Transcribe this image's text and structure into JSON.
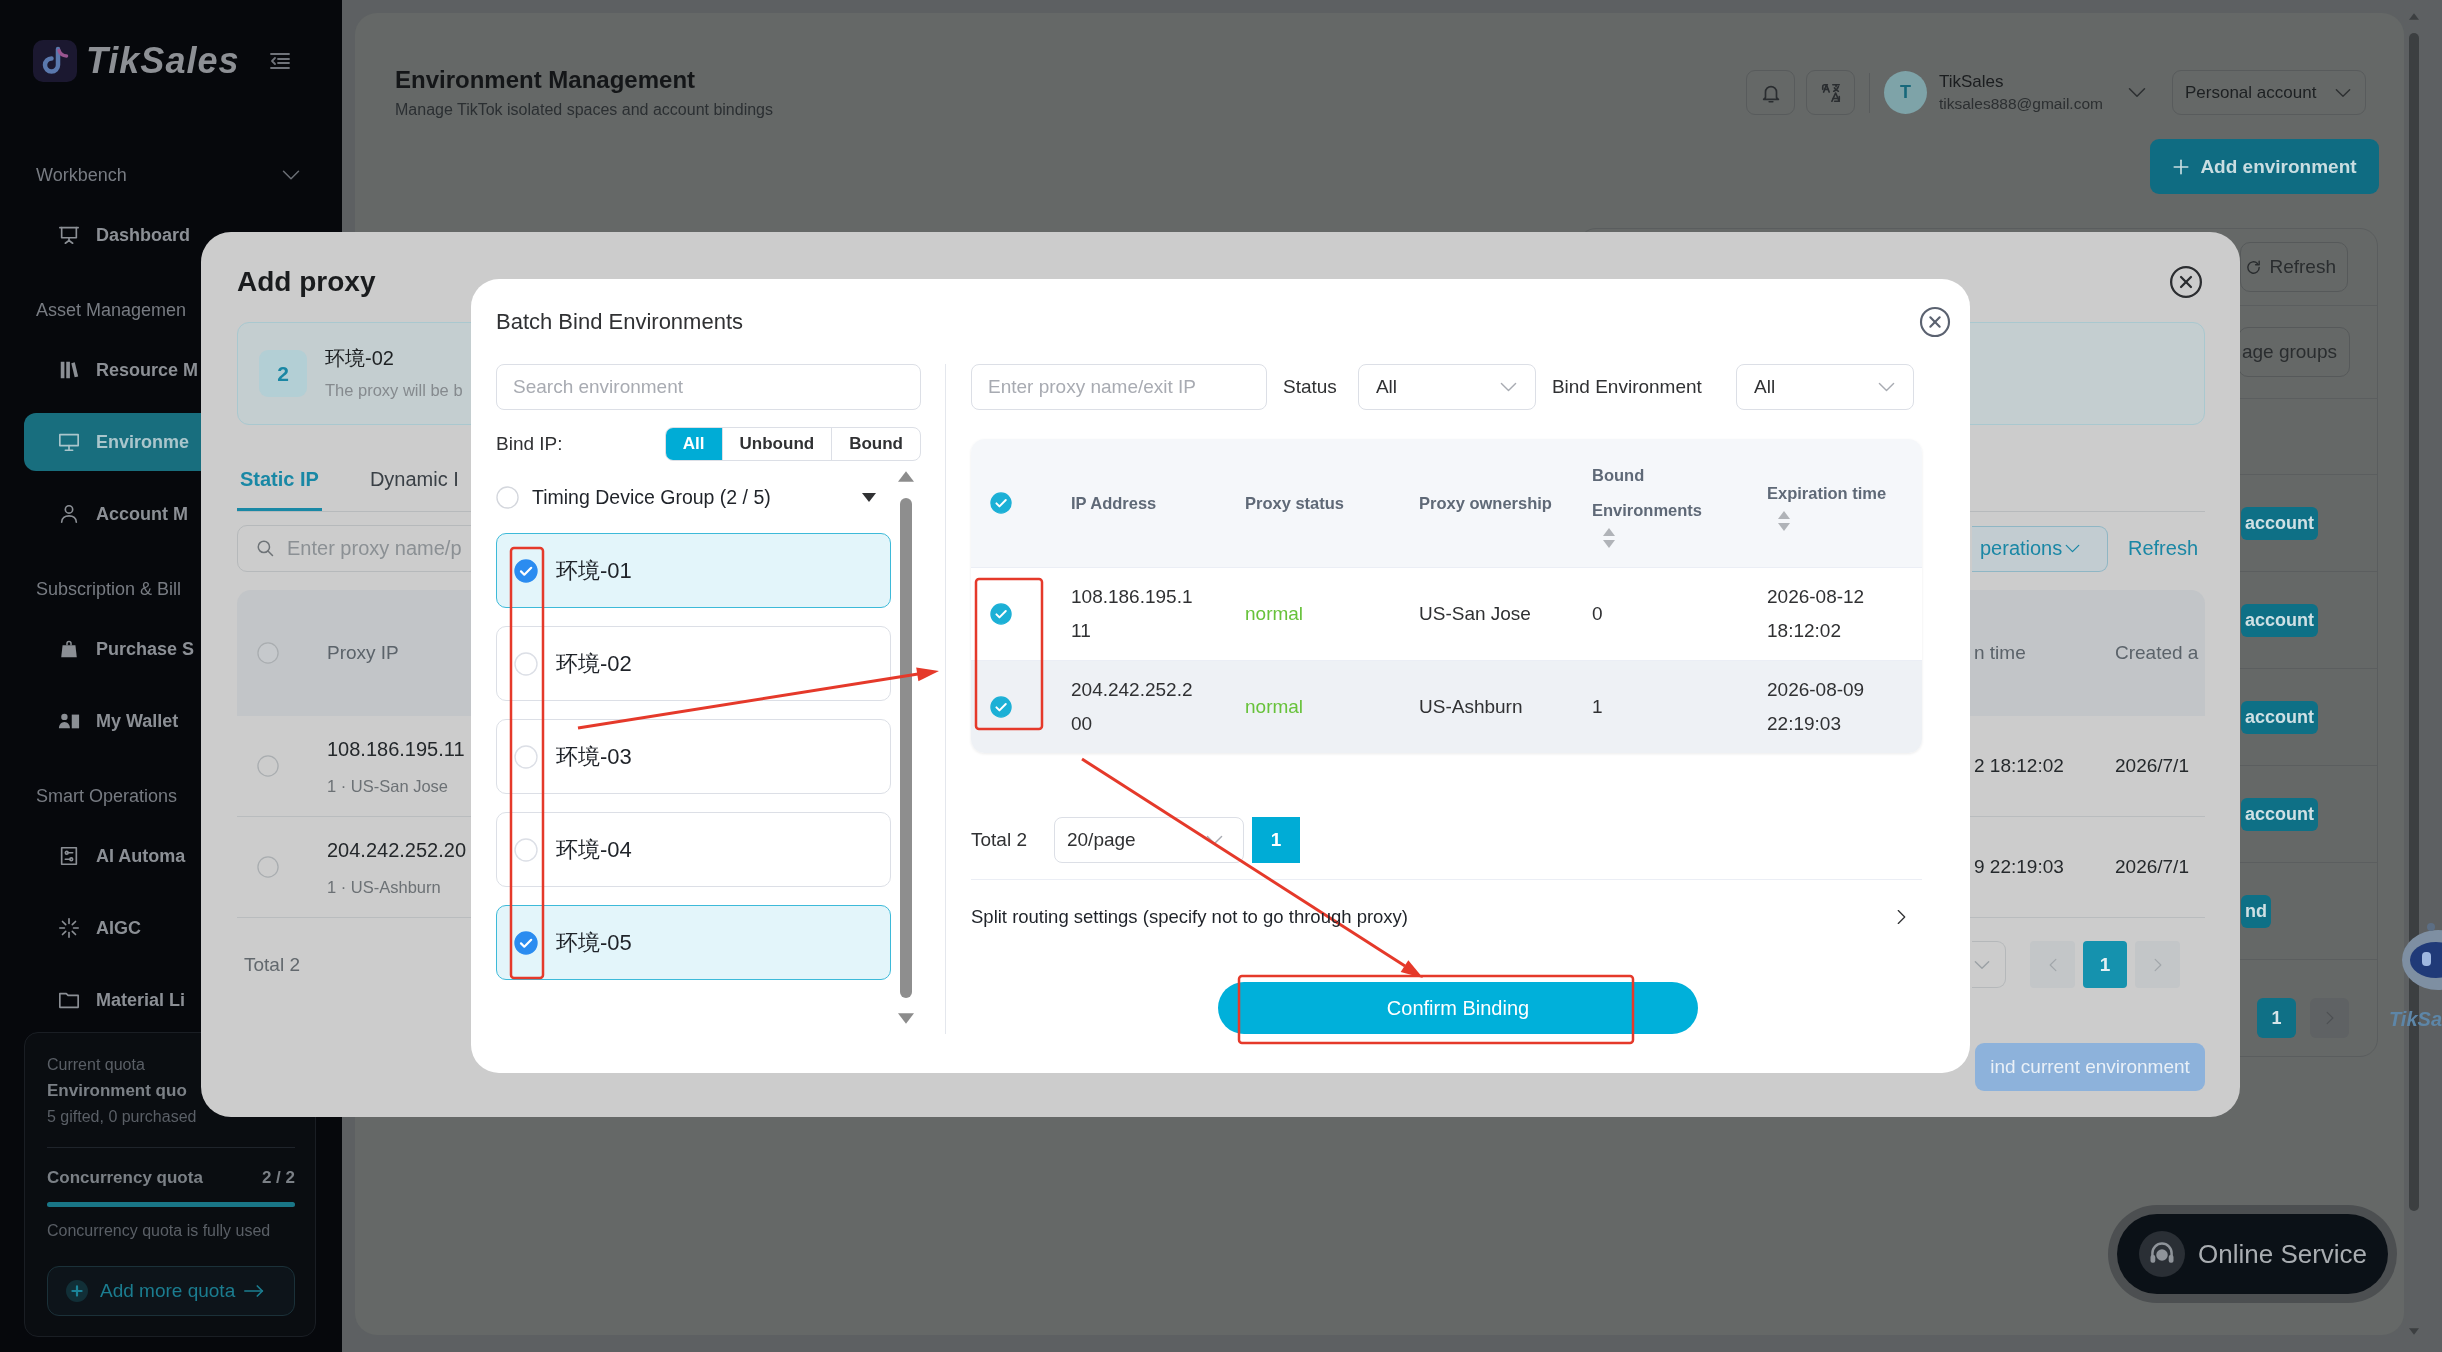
{
  "sidebar": {
    "brand": "TikSales",
    "sections": [
      {
        "title": "Workbench",
        "expanded": true,
        "items": [
          {
            "label": "Dashboard",
            "selected": false
          }
        ]
      },
      {
        "title": "Asset Managemen",
        "items": [
          {
            "label": "Resource M",
            "selected": false
          },
          {
            "label": "Environme",
            "selected": true
          },
          {
            "label": "Account M",
            "selected": false
          }
        ]
      },
      {
        "title": "Subscription & Bill",
        "items": [
          {
            "label": "Purchase S",
            "selected": false
          },
          {
            "label": "My Wallet",
            "selected": false
          }
        ]
      },
      {
        "title": "Smart Operations",
        "items": [
          {
            "label": "AI Automa",
            "selected": false
          },
          {
            "label": "AIGC",
            "selected": false
          },
          {
            "label": "Material Li",
            "selected": false
          }
        ]
      }
    ],
    "quota": {
      "caption": "Current quota",
      "title": "Environment quo",
      "detail": "5 gifted, 0 purchased",
      "concurrency_label": "Concurrency quota",
      "concurrency_value": "2 / 2",
      "level": 1,
      "note": "Concurrency quota is fully used",
      "button": "Add more quota"
    }
  },
  "header": {
    "title": "Environment Management",
    "subtitle": "Manage TikTok isolated spaces and account bindings",
    "user": {
      "initial": "T",
      "name": "TikSales",
      "email": "tiksales888@gmail.com"
    },
    "account_menu": "Personal account",
    "add_button": "Add environment"
  },
  "environment_list": {
    "refresh_button": "Refresh",
    "groups_button": "age groups",
    "rows": [
      {
        "tag": "account"
      },
      {
        "tag": "account"
      },
      {
        "tag": "account"
      },
      {
        "tag": "account"
      },
      {
        "tag": "nd"
      }
    ],
    "pagination": {
      "next_disabled": true,
      "pages": [
        {
          "label": "1",
          "selected": true
        }
      ]
    }
  },
  "add_proxy": {
    "title": "Add proxy",
    "environment": {
      "number": "2",
      "name": "环境-02",
      "note": "The proxy will be b"
    },
    "tabs": [
      {
        "label": "Static IP",
        "selected": true
      },
      {
        "label": "Dynamic I",
        "selected": false
      }
    ],
    "search": {
      "placeholder": "Enter proxy name/p"
    },
    "operations_button": "perations",
    "refresh_link": "Refresh",
    "table": {
      "all_checked": false,
      "columns": [
        "Proxy IP",
        "n time",
        "Created a"
      ],
      "rows": [
        {
          "checked": false,
          "cells": [
            "108.186.195.11",
            "2 18:12:02",
            "2026/7/1"
          ],
          "location": "1 · US-San Jose"
        },
        {
          "checked": false,
          "cells": [
            "204.242.252.20",
            "9 22:19:03",
            "2026/7/1"
          ],
          "location": "1 · US-Ashburn"
        }
      ]
    },
    "total": "Total 2",
    "pagination": {
      "prev_disabled": true,
      "next_disabled": true,
      "pages": [
        {
          "label": "1",
          "selected": true
        }
      ]
    },
    "bind_button": "ind current environment"
  },
  "batch_bind": {
    "title": "Batch Bind Environments",
    "environment_search": {
      "placeholder": "Search environment"
    },
    "bind_filter": {
      "label": "Bind IP:",
      "options": [
        {
          "label": "All",
          "selected": true
        },
        {
          "label": "Unbound",
          "selected": false
        },
        {
          "label": "Bound",
          "selected": false
        }
      ]
    },
    "group": {
      "label": "Timing Device Group (2 / 5)",
      "checked": false,
      "expanded": true
    },
    "environments": [
      {
        "name": "环境-01",
        "checked": true
      },
      {
        "name": "环境-02",
        "checked": false
      },
      {
        "name": "环境-03",
        "checked": false
      },
      {
        "name": "环境-04",
        "checked": false
      },
      {
        "name": "环境-05",
        "checked": true
      }
    ],
    "proxy_search": {
      "placeholder": "Enter proxy name/exit IP"
    },
    "status_filter": {
      "label": "Status",
      "value": "All"
    },
    "environment_filter": {
      "label": "Bind Environment",
      "value": "All"
    },
    "table": {
      "all_checked": true,
      "columns": [
        {
          "label": "IP Address",
          "kind": "ip",
          "sortable": false
        },
        {
          "label": "Proxy status",
          "kind": "status",
          "sortable": false
        },
        {
          "label": "Proxy ownership",
          "kind": "text",
          "sortable": false
        },
        {
          "label": "Bound Environments",
          "kind": "text",
          "sortable": true
        },
        {
          "label": "Expiration time",
          "kind": "time",
          "sortable": true
        }
      ],
      "rows": [
        {
          "checked": true,
          "hovered": false,
          "cells": [
            "108.186.195.111",
            "normal",
            "US-San Jose",
            "0",
            "2026-08-12 18:12:02"
          ]
        },
        {
          "checked": true,
          "hovered": true,
          "cells": [
            "204.242.252.200",
            "normal",
            "US-Ashburn",
            "1",
            "2026-08-09 22:19:03"
          ]
        }
      ]
    },
    "total": "Total 2",
    "page_size": "20/page",
    "pages": [
      {
        "label": "1",
        "selected": true
      }
    ],
    "split_routing": "Split routing settings (specify not to go through proxy)",
    "confirm_button": "Confirm Binding"
  },
  "assistant": {
    "label": "TikSa"
  },
  "online_service": {
    "label": "Online Service"
  }
}
